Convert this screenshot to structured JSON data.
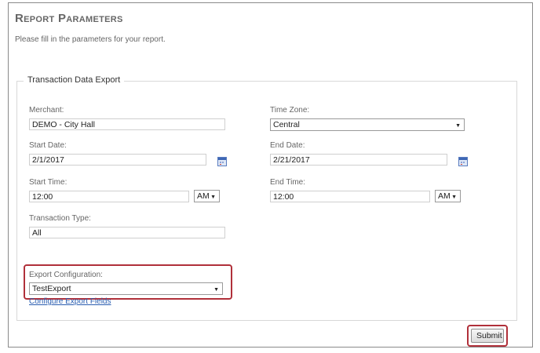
{
  "page": {
    "title": "Report Parameters",
    "subtitle": "Please fill in the parameters for your report."
  },
  "form": {
    "legend": "Transaction Data Export",
    "merchant": {
      "label": "Merchant:",
      "value": "DEMO - City Hall"
    },
    "time_zone": {
      "label": "Time Zone:",
      "value": "Central"
    },
    "start_date": {
      "label": "Start Date:",
      "value": "2/1/2017"
    },
    "end_date": {
      "label": "End Date:",
      "value": "2/21/2017"
    },
    "start_time": {
      "label": "Start Time:",
      "value": "12:00",
      "ampm": "AM"
    },
    "end_time": {
      "label": "End Time:",
      "value": "12:00",
      "ampm": "AM"
    },
    "transaction_type": {
      "label": "Transaction Type:",
      "value": "All"
    },
    "export_configuration": {
      "label": "Export Configuration:",
      "value": "TestExport"
    },
    "configure_link": "Configure Export Fields",
    "submit_label": "Submit"
  },
  "icons": {
    "select_arrow": "▼",
    "calendar": "calendar-icon"
  },
  "colors": {
    "highlight": "#b0303a",
    "link": "#2a5db0"
  }
}
